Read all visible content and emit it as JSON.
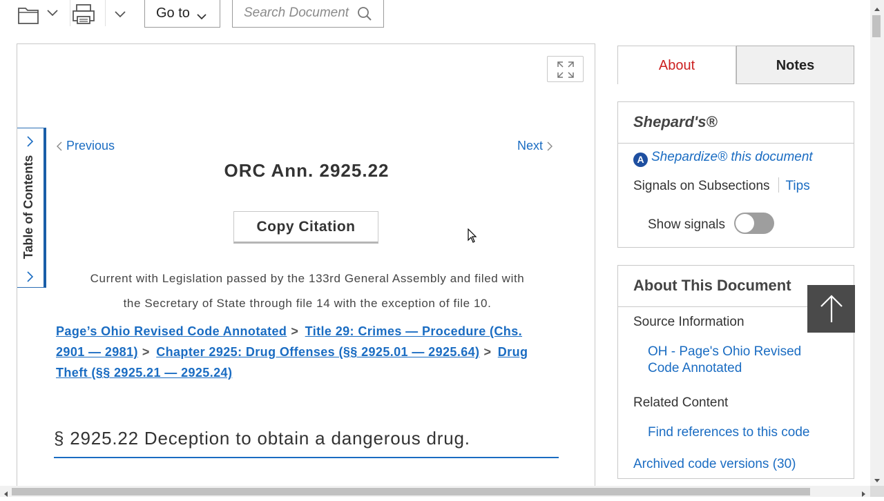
{
  "toolbar": {
    "folder_icon": "folder-icon",
    "print_icon": "printer-icon",
    "goto_label": "Go to",
    "search_placeholder": "Search Document"
  },
  "document": {
    "prev_label": "Previous",
    "next_label": "Next",
    "title": "ORC Ann. 2925.22",
    "copy_citation_label": "Copy Citation",
    "toc_label": "Table of Contents",
    "currency_line1": "Current with Legislation passed by the 133rd General Assembly and filed with",
    "currency_line2": "the Secretary of State through file 14 with the exception of file 10.",
    "breadcrumb": [
      "Page’s Ohio Revised Code Annotated",
      "Title 29: Crimes — Procedure (Chs. 2901 — 2981)",
      "Chapter 2925: Drug Offenses (§§ 2925.01 — 2925.64)",
      "Drug Theft (§§ 2925.21 — 2925.24)"
    ],
    "breadcrumb_separator": ">",
    "section_heading": "§ 2925.22 Deception to obtain a dangerous drug."
  },
  "sidebar": {
    "tabs": {
      "about": "About",
      "notes": "Notes"
    },
    "shepards": {
      "header": "Shepard's®",
      "badge": "A",
      "shepardize_link": "Shepardize® this document",
      "signals_label": "Signals on Subsections",
      "tips_link": "Tips",
      "show_signals_label": "Show signals",
      "show_signals_on": false
    },
    "about_doc": {
      "header": "About This Document",
      "source_label": "Source Information",
      "source_link": "OH - Page's Ohio Revised Code Annotated",
      "related_label": "Related Content",
      "find_refs_link": "Find references to this code",
      "archived_link": "Archived code versions (30)"
    }
  },
  "colors": {
    "link": "#1a6cc2",
    "active_tab": "#cc1f1f",
    "toggle_off": "#9e9e9e"
  }
}
